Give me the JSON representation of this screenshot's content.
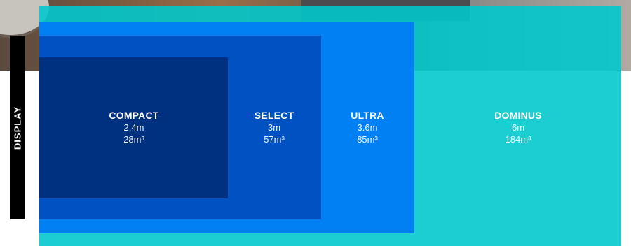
{
  "side_tab": {
    "label": "DISPLAY"
  },
  "models": [
    {
      "name": "COMPACT",
      "length": "2.4m",
      "volume": "28m³",
      "color": "#003181"
    },
    {
      "name": "SELECT",
      "length": "3m",
      "volume": "57m³",
      "color": "#0051c1"
    },
    {
      "name": "ULTRA",
      "length": "3.6m",
      "volume": "85m³",
      "color": "#0080f2"
    },
    {
      "name": "DOMINUS",
      "length": "6m",
      "volume": "184m³",
      "color": "#1acfd1"
    }
  ],
  "icons": {
    "background": "room-photo"
  }
}
